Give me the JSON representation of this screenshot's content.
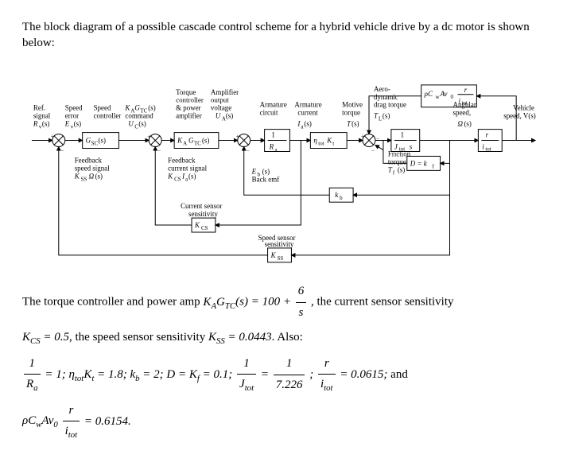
{
  "intro": "The block diagram of a possible cascade control scheme for a hybrid vehicle drive by a dc motor is shown below:",
  "labels": {
    "ref_signal_t1": "Ref.",
    "ref_signal_t2": "signal",
    "ref_signal_t3": "R_v(s)",
    "speed_err_t1": "Speed",
    "speed_err_t2": "error",
    "speed_err_t3": "E_v(s)",
    "speed_ctrl_t1": "Speed",
    "speed_ctrl_t2": "controller",
    "speed_ctrl_t3": "G_SC(s)",
    "torque_cmd_t1": "K_A G_TC(s)",
    "torque_cmd_t2": "command",
    "torque_cmd_t3": "U_C(s)",
    "torque_ctrl_t1": "Torque",
    "torque_ctrl_t2": "controller",
    "torque_ctrl_t3": "& power",
    "torque_ctrl_t4": "amplifier",
    "amp_out_t1": "Amplifier",
    "amp_out_t2": "output",
    "amp_out_t3": "voltage",
    "amp_out_t4": "U_A(s)",
    "armature_t1": "Armature",
    "armature_t2": "circuit",
    "arm_curr_t1": "Armature",
    "arm_curr_t2": "current",
    "arm_curr_t3": "I_a(s)",
    "motive_t1": "Motive",
    "motive_t2": "torque",
    "motive_t3": "T(s)",
    "aero_t1": "Aero-",
    "aero_t2": "dynamic",
    "aero_t3": "drag torque",
    "aero_t4": "T_L(s)",
    "ang_t1": "Angular",
    "ang_t2": "speed,",
    "ang_t3": "Ω(s)",
    "vehicle_t1": "Vehicle",
    "vehicle_t2": "speed, V(s)",
    "friction_t1": "Friction",
    "friction_t2": "torque",
    "friction_t3": "T_f (s)",
    "back_emf_t1": "E_b (s)",
    "back_emf_t2": "Back emf",
    "fb_curr_t1": "Feedback",
    "fb_curr_t2": "current signal",
    "fb_curr_t3": "K_CS I_a(s)",
    "fb_speed_t1": "Feedback",
    "fb_speed_t2": "speed signal",
    "fb_speed_t3": "K_SS Ω(s)",
    "cs_sens_t1": "Current sensor",
    "cs_sens_t2": "sensitivity",
    "ss_sens_t1": "Speed sensor",
    "ss_sens_t2": "sensitivity",
    "block_gsc": "G_SC(s)",
    "block_ka": "K_A G_TC(s)",
    "block_Ra": "1 / R_a",
    "block_ntotKt": "η_tot K_t",
    "block_Jtot": "1 / (J_tot s)",
    "block_ritot": "r / i_tot",
    "block_D": "D = k_f",
    "block_kb": "k_b",
    "block_Kcs": "K_CS",
    "block_Kss": "K_SS",
    "block_rhoC": "ρ C_w A_v₀ (r / i_tot)"
  },
  "text": {
    "p1a": "The torque controller and power amp ",
    "p1b": ", the current sensor sensitivity",
    "kgtc_lhs": "K_A G_TC (s) =",
    "kgtc_const": "100 +",
    "kcs": "K_CS = 0.5",
    "p2a": ", the speed sensor sensitivity ",
    "kss": "K_SS = 0.0443",
    "p2b": ". Also:",
    "eqA": "1 / R_a = 1; η_tot K_t = 1.8; k_b = 2; D = K_f = 0.1;",
    "eqB_lhs": "1 / J_tot = 1 / 7.226",
    "eqB_mid": ";",
    "eqC": "r / i_tot = 0.0615;",
    "eqC_tail": " and",
    "eqD": "ρ C_w A v₀ (r / i_tot) = 0.6154."
  },
  "chart_data": {
    "type": "block-diagram",
    "forward_path": [
      {
        "node": "sum",
        "inputs": [
          "R_v(s)+",
          "K_SS Ω(s)-"
        ],
        "output": "E_v(s)"
      },
      {
        "node": "block",
        "name": "Speed controller",
        "tf": "G_SC(s)",
        "output": "U_C(s)"
      },
      {
        "node": "sum",
        "inputs": [
          "U_C(s)+",
          "K_CS I_a(s)-"
        ]
      },
      {
        "node": "block",
        "name": "Torque controller & power amplifier",
        "tf": "K_A G_TC(s)",
        "output": "U_A(s)"
      },
      {
        "node": "sum",
        "inputs": [
          "U_A(s)+",
          "E_b(s)-"
        ]
      },
      {
        "node": "block",
        "name": "Armature circuit",
        "tf": "1/R_a",
        "output": "I_a(s)"
      },
      {
        "node": "block",
        "tf": "η_tot K_t",
        "output": "T(s) motive torque"
      },
      {
        "node": "sum",
        "inputs": [
          "T(s)+",
          "T_L(s)-",
          "T_f(s)-"
        ]
      },
      {
        "node": "block",
        "tf": "1/(J_tot s)",
        "output": "Ω(s)"
      },
      {
        "node": "block",
        "tf": "r/i_tot",
        "output": "V(s)"
      }
    ],
    "feedback_paths": [
      {
        "from": "Ω(s)",
        "tf": "D = k_f",
        "to": "torque sum (T_f)",
        "label": "Friction torque"
      },
      {
        "from": "Ω(s)",
        "tf": "k_b",
        "to": "armature voltage sum",
        "label": "Back emf E_b(s)"
      },
      {
        "from": "Ω(s)",
        "tf": "ρ C_w A v₀ (r/i_tot)",
        "to": "torque sum (T_L)",
        "label": "Aero drag torque"
      },
      {
        "from": "I_a(s)",
        "tf": "K_CS",
        "to": "current sum",
        "label": "Current feedback"
      },
      {
        "from": "Ω(s)",
        "tf": "K_SS",
        "to": "speed sum",
        "label": "Speed feedback"
      }
    ],
    "parameters": {
      "K_A G_TC(s)": "100 + 6/s",
      "K_CS": 0.5,
      "K_SS": 0.0443,
      "1/R_a": 1,
      "eta_tot K_t": 1.8,
      "k_b": 2,
      "D = K_f": 0.1,
      "1/J_tot": 0.1384,
      "J_tot": 7.226,
      "r/i_tot": 0.0615,
      "rho C_w A v0 (r/i_tot)": 0.6154
    }
  }
}
